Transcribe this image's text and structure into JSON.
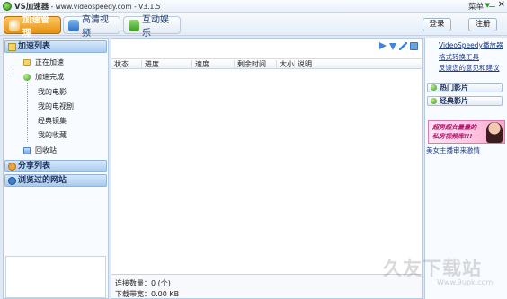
{
  "titlebar": {
    "app_name": "VS加速器",
    "subtitle": " - www.videospeedy.com - V3.1.5",
    "menu": "菜单",
    "minimize": "－",
    "close": "✕"
  },
  "toolbar": {
    "tabs": [
      {
        "label": "加速管理",
        "icon": "rocket-icon",
        "active": true
      },
      {
        "label": "高清视频",
        "icon": "video-icon",
        "active": false
      },
      {
        "label": "互动娱乐",
        "icon": "game-icon",
        "active": false
      }
    ],
    "login": "登录",
    "register": "注册"
  },
  "sidebar": {
    "accel_list": "加速列表",
    "accelerating": "正在加速",
    "accel_done": "加速完成",
    "children": [
      "我的电影",
      "我的电视剧",
      "经典镜集",
      "我的收藏"
    ],
    "recycle": "回收站",
    "share_list": "分享列表",
    "visited_sites": "浏览过的网站"
  },
  "main": {
    "columns": [
      "状态",
      "进度",
      "速度",
      "剩余时间",
      "大小",
      "说明"
    ],
    "conn_count": "连接数量：0 (个)",
    "bandwidth": "下载带宽：0.00 KB"
  },
  "right": {
    "links": [
      "VideoSpeedy播放器",
      "格式转换工具",
      "反馈您的意见和建议"
    ],
    "hot_movies": "热门影片",
    "classic_movies": "经典影片",
    "banner_text": [
      "超男超女量量的",
      "私房视频库!!!"
    ],
    "banner_link": "美女主播审来激情"
  },
  "watermark": {
    "main": "久友下载站",
    "sub": "Www.9upk.com"
  },
  "colors": {
    "accent_orange": "#e6900f",
    "header_blue": "#a9cbf0",
    "link_blue": "#1a3a8a",
    "status_green": "#3c9b22"
  }
}
